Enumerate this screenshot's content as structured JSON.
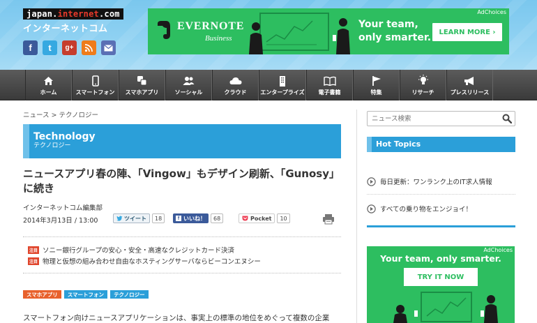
{
  "site": {
    "logo_prefix": "japan.",
    "logo_highlight": "internet",
    "logo_suffix": ".com",
    "logo_jp": "インターネットコム"
  },
  "social": {
    "facebook": "f",
    "twitter": "t",
    "googleplus": "g+",
    "rss": "rss-icon",
    "mail": "mail-icon"
  },
  "ad_top": {
    "ad_choices": "AdChoices",
    "brand": "EVERNOTE",
    "brand_sub": "Business",
    "slogan_line1": "Your team,",
    "slogan_line2": "only smarter.",
    "cta": "LEARN MORE ›"
  },
  "nav": {
    "items": [
      {
        "label": "ホーム",
        "icon": "home-icon"
      },
      {
        "label": "スマートフォン",
        "icon": "smartphone-icon"
      },
      {
        "label": "スマホアプリ",
        "icon": "apps-icon"
      },
      {
        "label": "ソーシャル",
        "icon": "people-icon"
      },
      {
        "label": "クラウド",
        "icon": "cloud-icon"
      },
      {
        "label": "エンタープライズ",
        "icon": "building-icon"
      },
      {
        "label": "電子書籍",
        "icon": "book-icon"
      },
      {
        "label": "特集",
        "icon": "flag-icon"
      },
      {
        "label": "リサーチ",
        "icon": "lightbulb-icon"
      },
      {
        "label": "プレスリリース",
        "icon": "megaphone-icon"
      }
    ]
  },
  "breadcrumb": "ニュース > テクノロジー",
  "category": {
    "en": "Technology",
    "jp": "テクノロジー"
  },
  "article": {
    "title": "ニュースアプリ春の陣、「Vingow」もデザイン刷新、「Gunosy」に続き",
    "author": "インターネットコム編集部",
    "date": "2014年3月13日 / 13:00",
    "share": {
      "tweet_label": "ツイート",
      "tweet_count": "18",
      "like_label": "いいね！",
      "like_count": "68",
      "pocket_label": "Pocket",
      "pocket_count": "10"
    },
    "promos": [
      {
        "badge": "注目",
        "text": "ソニー銀行グループの安心・安全・高速なクレジットカード決済"
      },
      {
        "badge": "注目",
        "text": "物理と仮想の組み合わせ自由なホスティングサーバならビーコンエヌシー"
      }
    ],
    "tags": [
      "スマホアプリ",
      "スマートフォン",
      "テクノロジー"
    ],
    "body_start": "スマートフォン向けニュースアプリケーションは、事実上の標準の地位をめぐって複数の企業"
  },
  "sidebar": {
    "search_placeholder": "ニュース検索",
    "hot_topics_title": "Hot Topics",
    "hot_topics": [
      "毎日更新：ワンランク上のIT求人情報",
      "すべての乗り物をエンジョイ！"
    ],
    "ad": {
      "ad_choices": "AdChoices",
      "slogan": "Your team, only smarter.",
      "cta": "TRY IT NOW"
    }
  },
  "colors": {
    "accent_blue": "#2b9fd9",
    "evernote_green": "#2dbe60",
    "nav_dark": "#3a3a3a"
  }
}
